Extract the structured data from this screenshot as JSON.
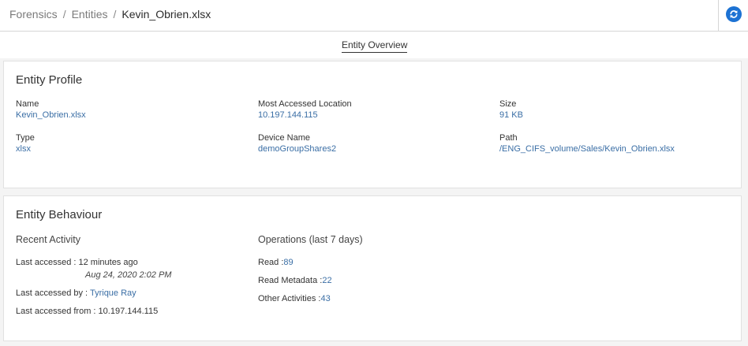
{
  "breadcrumb": {
    "items": [
      "Forensics",
      "Entities"
    ],
    "separator": "/",
    "current": "Kevin_Obrien.xlsx"
  },
  "header": {
    "refresh_icon": "refresh-icon"
  },
  "tabs": [
    {
      "label": "Entity Overview",
      "active": true
    }
  ],
  "profile": {
    "title": "Entity Profile",
    "name": {
      "label": "Name",
      "value": "Kevin_Obrien.xlsx"
    },
    "location": {
      "label": "Most Accessed Location",
      "value": "10.197.144.115"
    },
    "size": {
      "label": "Size",
      "value": "91 KB"
    },
    "type": {
      "label": "Type",
      "value": "xlsx"
    },
    "device": {
      "label": "Device Name",
      "value": "demoGroupShares2"
    },
    "path": {
      "label": "Path",
      "value": "/ENG_CIFS_volume/Sales/Kevin_Obrien.xlsx"
    }
  },
  "behaviour": {
    "title": "Entity Behaviour",
    "recent": {
      "title": "Recent Activity",
      "last_accessed_label": "Last accessed : ",
      "last_accessed_value": "12 minutes ago",
      "last_accessed_date": "Aug 24, 2020 2:02 PM",
      "by_label": "Last accessed by : ",
      "by_value": "Tyrique Ray",
      "from_label": "Last accessed from : ",
      "from_value": "10.197.144.115"
    },
    "operations": {
      "title": "Operations (last 7 days)",
      "items": [
        {
          "label": "Read :",
          "value": "89"
        },
        {
          "label": "Read Metadata :",
          "value": "22"
        },
        {
          "label": "Other Activities :",
          "value": "43"
        }
      ]
    }
  },
  "colors": {
    "accent": "#1c72d3",
    "link": "#3a6ea5"
  }
}
